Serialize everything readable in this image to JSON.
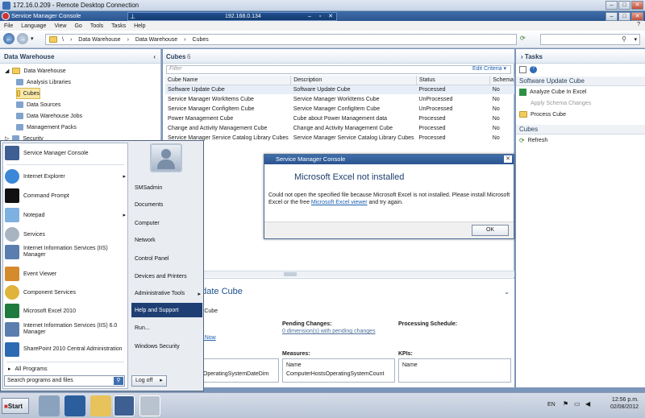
{
  "rdp": {
    "title": "172.16.0.209 - Remote Desktop Connection",
    "ip": "192.168.0.134"
  },
  "app": {
    "title": "Service Manager Console"
  },
  "menu": [
    "File",
    "Language",
    "View",
    "Go",
    "Tools",
    "Tasks",
    "Help"
  ],
  "breadcrumb": [
    "\\",
    "Data Warehouse",
    "Data Warehouse",
    "Cubes"
  ],
  "left": {
    "title": "Data Warehouse",
    "items": [
      "Data Warehouse",
      "Analysis Libraries",
      "Cubes",
      "Data Sources",
      "Data Warehouse Jobs",
      "Management Packs",
      "Security"
    ]
  },
  "cubes": {
    "title": "Cubes",
    "count": "6",
    "filter_placeholder": "Filter",
    "edit_criteria": "Edit Criteria",
    "columns": [
      "Cube Name",
      "Description",
      "Status",
      "Schema"
    ],
    "rows": [
      [
        "Software Update Cube",
        "Software Update Cube",
        "Processed",
        "No"
      ],
      [
        "Service Manager WorkItems Cube",
        "Service Manager WorkItems Cube",
        "UnProcessed",
        "No"
      ],
      [
        "Service Manager ConfigItem Cube",
        "Service Manager ConfigItem Cube",
        "UnProcessed",
        "No"
      ],
      [
        "Power Management Cube",
        "Cube about Power Management data",
        "Processed",
        "No"
      ],
      [
        "Change and Activity Management Cube",
        "Change and Activity Management Cube",
        "Processed",
        "No"
      ],
      [
        "Service Manager Service Catalog Library Cubes",
        "Service Manager Service Catalog Library Cubes",
        "Processed",
        "No"
      ]
    ]
  },
  "detail": {
    "title": "pdate Cube",
    "sub": "ze Cube",
    "link": "be Now",
    "pending_label": "Pending Changes:",
    "pending_value": "0 dimension(s) with pending changes",
    "schedule_label": "Processing Schedule:",
    "measures_label": "Measures:",
    "kpis_label": "KPIs:",
    "name_col": "Name",
    "measure_item": "ComputerHostsOperatingSystemCount",
    "left_item": "stsOperatingSystemDateDim"
  },
  "tasks": {
    "title": "Tasks",
    "section1": "Software Update Cube",
    "items1": [
      "Analyze Cube In Excel",
      "Apply Schema Changes",
      "Process Cube"
    ],
    "section2": "Cubes",
    "items2": [
      "Refresh"
    ]
  },
  "startmenu": {
    "left": [
      "Service Manager Console",
      "Internet Explorer",
      "Command Prompt",
      "Notepad",
      "Services",
      "Internet Information Services (IIS) Manager",
      "Event Viewer",
      "Component Services",
      "Microsoft Excel 2010",
      "Internet Information Services (IIS) 6.0 Manager",
      "SharePoint 2010 Central Administration"
    ],
    "all_programs": "All Programs",
    "right": [
      "SMSadmin",
      "Documents",
      "Computer",
      "Network",
      "Control Panel",
      "Devices and Printers",
      "Administrative Tools",
      "Help and Support",
      "Run...",
      "Windows Security"
    ],
    "search_placeholder": "Search programs and files",
    "logoff": "Log off"
  },
  "dialog": {
    "title": "Service Manager Console",
    "heading": "Microsoft Excel not installed",
    "msg1": "Could not open the specified file because Microsoft Excel is not installed. Please install Microsoft Excel or the free ",
    "link": "Microsoft Excel viewer",
    "msg2": " and try again.",
    "ok": "OK"
  },
  "taskbar": {
    "start": "Start",
    "lang": "EN",
    "time": "12:56 p.m.",
    "date": "02/08/2012"
  }
}
